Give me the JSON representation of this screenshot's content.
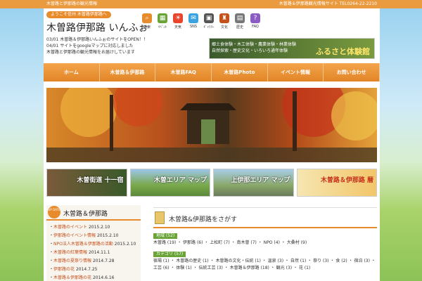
{
  "topbar": {
    "left": "木曽路と伊那路の観光情報",
    "right": "木曽路＆伊那路観光情報サイト TEL0264-22-2210"
  },
  "header": {
    "tagline": "ようこそ信州 木曽路伊那路へ",
    "logo": "木曽路伊那路 いんふぉ"
  },
  "icons": [
    {
      "name": "search-icon",
      "label": "検索",
      "color": "#e88b2c",
      "glyph": "⌕"
    },
    {
      "name": "event-icon",
      "label": "ｲﾍﾞﾝﾄ",
      "color": "#6aa336",
      "glyph": "▦"
    },
    {
      "name": "weather-icon",
      "label": "天気",
      "color": "#e8452c",
      "glyph": "☀"
    },
    {
      "name": "sns-icon",
      "label": "SNS",
      "color": "#3aa3e0",
      "glyph": "✉"
    },
    {
      "name": "gallery-icon",
      "label": "ｷﾞｬﾗﾘｰ",
      "color": "#555",
      "glyph": "▣"
    },
    {
      "name": "culture-icon",
      "label": "文化",
      "color": "#c4501a",
      "glyph": "♜"
    },
    {
      "name": "history-icon",
      "label": "歴史",
      "color": "#777",
      "glyph": "▤"
    },
    {
      "name": "faq-icon",
      "label": "FAQ",
      "color": "#8a5cc4",
      "glyph": "?"
    }
  ],
  "news": [
    "03/01 木曽路＆伊那路いんふぉのサイトをOPEN！！",
    "04/01 サイトをgoogleマップに対応しました",
    "木曽路と伊那路の観光情報をお届けしています"
  ],
  "banner": {
    "lines": [
      "郷土食体験・木工体験・農業体験・林業体験",
      "自然探索・歴史文化・いろいろ通年体験"
    ],
    "title": "ふるさと体験館"
  },
  "nav": [
    "ホーム",
    "木曽路＆伊那路",
    "木曽路FAQ",
    "木曽路Photo",
    "イベント情報",
    "お問い合わせ"
  ],
  "tiles": [
    "木曽街道 十一宿",
    "木曽エリア マップ",
    "上伊那エリア マップ",
    "木曽路＆伊那路 暦"
  ],
  "side": {
    "badge": "UP DATE",
    "title": "木曽路＆伊那路",
    "updates": [
      {
        "text": "木曽路のイベント",
        "date": "2015.2.10"
      },
      {
        "text": "伊那路のイベント情報",
        "date": "2015.2.10"
      },
      {
        "text": "NPO法人木曽路＆伊那路の活動",
        "date": "2015.2.10"
      },
      {
        "text": "木曽路の紅葉情報",
        "date": "2014.11.1"
      },
      {
        "text": "木曽路の夏祭り情報",
        "date": "2014.7.28"
      },
      {
        "text": "伊那路の花",
        "date": "2014.7.25"
      },
      {
        "text": "木曽路＆伊那路の花",
        "date": "2014.6.16"
      }
    ]
  },
  "main": {
    "title": "木曽路&伊那路をさがす",
    "cats": [
      {
        "label": "地域 (52)",
        "items": "木曽路 (19) ・ 伊那路 (6) ・ 上松町 (7) ・ 南木曽 (7) ・ NPO (4) ・ 大桑村 (9)"
      },
      {
        "label": "カテゴリ (57)",
        "items": "宿場 (1) ・ 木曽路の歴史 (1) ・ 木曽路の文化・伝統 (1) ・ 温泉 (3) ・ 自然 (1) ・ 祭り (3) ・ 食 (2) ・ 宿泊 (3) ・ 工芸 (6) ・ 体験 (1) ・ 伝統工芸 (3) ・ 木曽路＆伊那路 (18) ・ 観光 (3) ・ 花 (1)"
      }
    ]
  },
  "colors": {
    "accent": "#e88b2c",
    "green": "#6aa336"
  }
}
